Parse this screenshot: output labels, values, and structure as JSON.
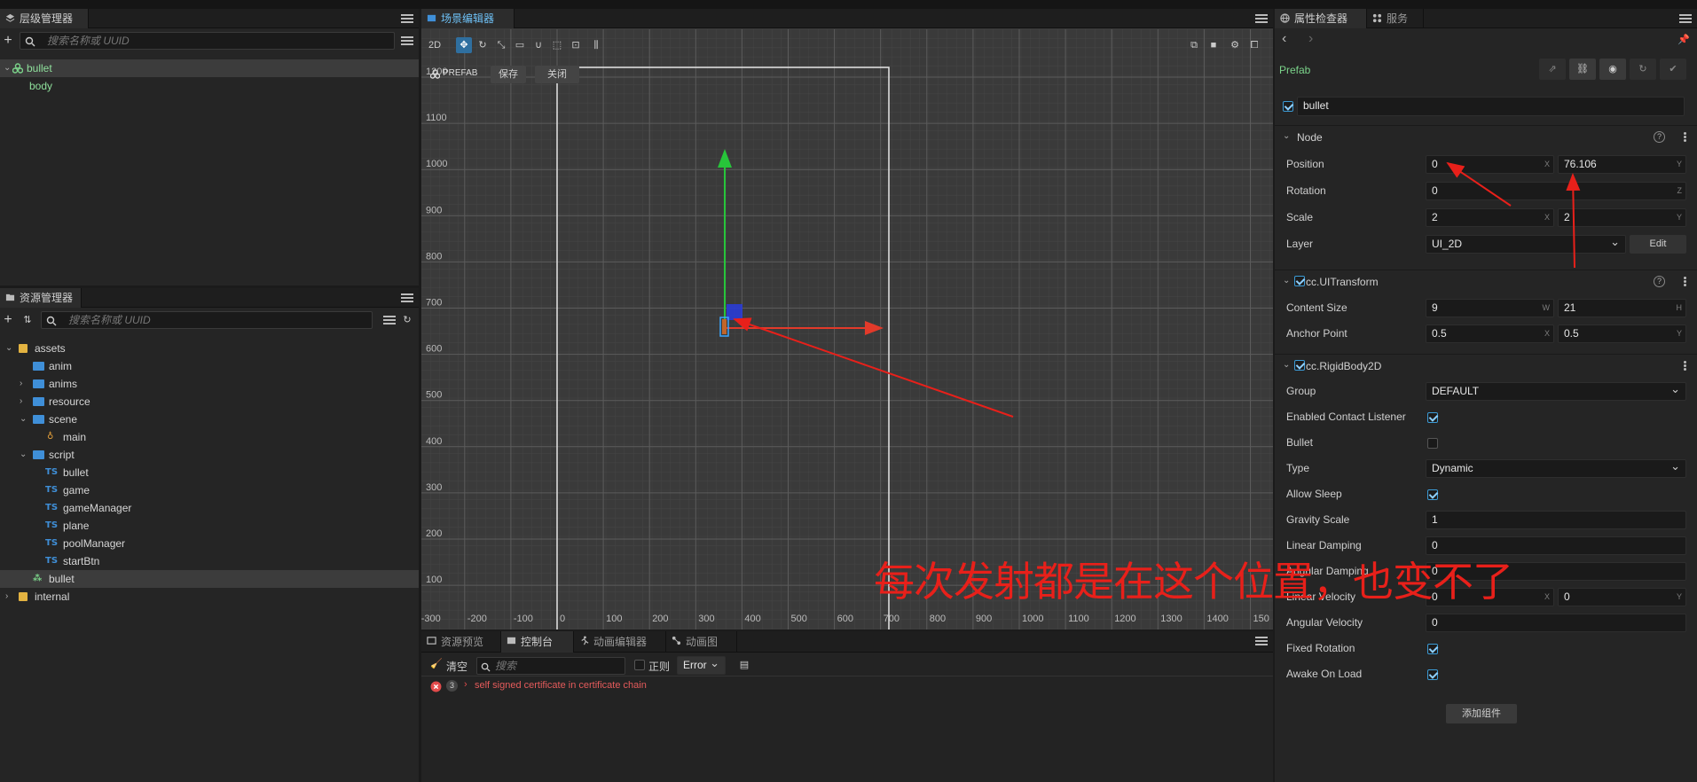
{
  "hierarchy": {
    "tab_label": "层级管理器",
    "search_placeholder": "搜索名称或 UUID",
    "nodes": [
      {
        "label": "bullet",
        "selected": true
      },
      {
        "label": "body"
      }
    ]
  },
  "assets": {
    "tab_label": "资源管理器",
    "search_placeholder": "搜索名称或 UUID",
    "items": [
      {
        "label": "assets",
        "kind": "db",
        "expanded": true
      },
      {
        "label": "anim",
        "kind": "folder"
      },
      {
        "label": "anims",
        "kind": "folder"
      },
      {
        "label": "resource",
        "kind": "folder"
      },
      {
        "label": "scene",
        "kind": "folder",
        "expanded": true
      },
      {
        "label": "main",
        "kind": "scene"
      },
      {
        "label": "script",
        "kind": "folder",
        "expanded": true
      },
      {
        "label": "bullet",
        "kind": "ts"
      },
      {
        "label": "game",
        "kind": "ts"
      },
      {
        "label": "gameManager",
        "kind": "ts"
      },
      {
        "label": "plane",
        "kind": "ts"
      },
      {
        "label": "poolManager",
        "kind": "ts"
      },
      {
        "label": "startBtn",
        "kind": "ts"
      },
      {
        "label": "bullet",
        "kind": "prefab",
        "selected": true
      },
      {
        "label": "internal",
        "kind": "db"
      }
    ]
  },
  "scene": {
    "tab_label": "场景编辑器",
    "mode_2d": "2D",
    "prefab_label": "PREFAB",
    "save_label": "保存",
    "close_label": "关闭",
    "y_ticks": [
      "1200",
      "1100",
      "1000",
      "900",
      "800",
      "700",
      "600",
      "500",
      "400",
      "300",
      "200",
      "100"
    ],
    "x_ticks": [
      "-300",
      "-200",
      "-100",
      "0",
      "100",
      "200",
      "300",
      "400",
      "500",
      "600",
      "700",
      "800",
      "900",
      "1000",
      "1100",
      "1200",
      "1300",
      "1400",
      "150"
    ]
  },
  "console": {
    "tabs": [
      "资源预览",
      "控制台",
      "动画编辑器",
      "动画图"
    ],
    "clear_label": "清空",
    "search_placeholder": "搜索",
    "regex_label": "正则",
    "level": "Error",
    "error_count": "3",
    "error_message": "self signed certificate in certificate chain"
  },
  "annotation": {
    "text": "每次发射都是在这个位置，也变不了",
    "color": "#e8201a"
  },
  "inspector": {
    "tab_label": "属性检查器",
    "tab_service": "服务",
    "prefab_label": "Prefab",
    "node_name": "bullet",
    "node_section": "Node",
    "position_label": "Position",
    "position_x": "0",
    "position_y": "76.106",
    "rotation_label": "Rotation",
    "rotation_z": "0",
    "scale_label": "Scale",
    "scale_x": "2",
    "scale_y": "2",
    "layer_label": "Layer",
    "layer_value": "UI_2D",
    "edit_label": "Edit",
    "uitransform_label": "cc.UITransform",
    "content_size_label": "Content Size",
    "content_w": "9",
    "content_h": "21",
    "anchor_label": "Anchor Point",
    "anchor_x": "0.5",
    "anchor_y": "0.5",
    "rigidbody_label": "cc.RigidBody2D",
    "group_label": "Group",
    "group_value": "DEFAULT",
    "contact_label": "Enabled Contact Listener",
    "bullet_label": "Bullet",
    "type_label": "Type",
    "type_value": "Dynamic",
    "allow_sleep_label": "Allow Sleep",
    "gravity_label": "Gravity Scale",
    "gravity_value": "1",
    "linear_damping_label": "Linear Damping",
    "linear_damping_value": "0",
    "angular_damping_label": "Angular Damping",
    "angular_damping_value": "0",
    "linear_velocity_label": "Linear Velocity",
    "linear_velocity_x": "0",
    "linear_velocity_y": "0",
    "angular_velocity_label": "Angular Velocity",
    "angular_velocity_value": "0",
    "fixed_rotation_label": "Fixed Rotation",
    "awake_label": "Awake On Load",
    "add_component_label": "添加组件",
    "axis": {
      "x": "X",
      "y": "Y",
      "z": "Z",
      "w": "W",
      "h": "H"
    }
  }
}
